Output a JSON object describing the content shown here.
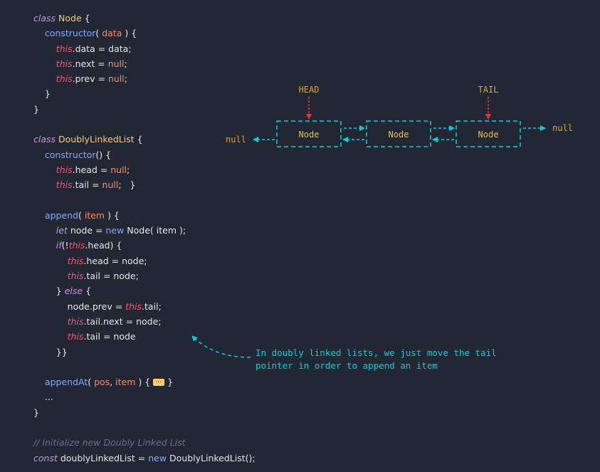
{
  "code_lines": [
    [
      {
        "t": "class",
        "c": "kw"
      },
      {
        "t": " "
      },
      {
        "t": "Node",
        "c": "cls"
      },
      {
        "t": " {"
      }
    ],
    [
      {
        "t": "    "
      },
      {
        "t": "constructor",
        "c": "fn"
      },
      {
        "t": "( "
      },
      {
        "t": "data",
        "c": "param"
      },
      {
        "t": " ) {"
      }
    ],
    [
      {
        "t": "        "
      },
      {
        "t": "this",
        "c": "this"
      },
      {
        "t": ".data = data;"
      }
    ],
    [
      {
        "t": "        "
      },
      {
        "t": "this",
        "c": "this"
      },
      {
        "t": ".next = "
      },
      {
        "t": "null",
        "c": "lit"
      },
      {
        "t": ";"
      }
    ],
    [
      {
        "t": "        "
      },
      {
        "t": "this",
        "c": "this"
      },
      {
        "t": ".prev = "
      },
      {
        "t": "null",
        "c": "lit"
      },
      {
        "t": ";"
      }
    ],
    [
      {
        "t": "    }"
      }
    ],
    [
      {
        "t": "}"
      }
    ],
    [],
    [
      {
        "t": "class",
        "c": "kw"
      },
      {
        "t": " "
      },
      {
        "t": "DoublyLinkedList",
        "c": "cls"
      },
      {
        "t": " {"
      }
    ],
    [
      {
        "t": "    "
      },
      {
        "t": "constructor",
        "c": "fn"
      },
      {
        "t": "() {"
      }
    ],
    [
      {
        "t": "        "
      },
      {
        "t": "this",
        "c": "this"
      },
      {
        "t": ".head = "
      },
      {
        "t": "null",
        "c": "lit"
      },
      {
        "t": ";"
      }
    ],
    [
      {
        "t": "        "
      },
      {
        "t": "this",
        "c": "this"
      },
      {
        "t": ".tail = "
      },
      {
        "t": "null",
        "c": "lit"
      },
      {
        "t": ";   }"
      }
    ],
    [],
    [
      {
        "t": "    "
      },
      {
        "t": "append",
        "c": "fn"
      },
      {
        "t": "( "
      },
      {
        "t": "item",
        "c": "param"
      },
      {
        "t": " ) {"
      }
    ],
    [
      {
        "t": "        "
      },
      {
        "t": "let",
        "c": "kw"
      },
      {
        "t": " node = "
      },
      {
        "t": "new",
        "c": "fn"
      },
      {
        "t": " Node( item );"
      }
    ],
    [
      {
        "t": "        "
      },
      {
        "t": "if",
        "c": "kw"
      },
      {
        "t": "(!"
      },
      {
        "t": "this",
        "c": "this"
      },
      {
        "t": ".head) {"
      }
    ],
    [
      {
        "t": "            "
      },
      {
        "t": "this",
        "c": "this"
      },
      {
        "t": ".head = node;"
      }
    ],
    [
      {
        "t": "            "
      },
      {
        "t": "this",
        "c": "this"
      },
      {
        "t": ".tail = node;"
      }
    ],
    [
      {
        "t": "        } "
      },
      {
        "t": "else",
        "c": "kw"
      },
      {
        "t": " {"
      }
    ],
    [
      {
        "t": "            node.prev = "
      },
      {
        "t": "this",
        "c": "this"
      },
      {
        "t": ".tail;"
      }
    ],
    [
      {
        "t": "            "
      },
      {
        "t": "this",
        "c": "this"
      },
      {
        "t": ".tail.next = node;"
      }
    ],
    [
      {
        "t": "            "
      },
      {
        "t": "this",
        "c": "this"
      },
      {
        "t": ".tail = node"
      }
    ],
    [
      {
        "t": "        }}"
      }
    ],
    [],
    [
      {
        "t": "    "
      },
      {
        "t": "appendAt",
        "c": "fn"
      },
      {
        "t": "( "
      },
      {
        "t": "pos",
        "c": "param"
      },
      {
        "t": ", "
      },
      {
        "t": "item",
        "c": "param"
      },
      {
        "t": " ) { "
      },
      {
        "t": "",
        "c": "fold"
      },
      {
        "t": " }"
      }
    ],
    [
      {
        "t": "    ..."
      }
    ],
    [
      {
        "t": "}"
      }
    ],
    [],
    [
      {
        "t": "// Initialize new Doubly Linked List",
        "c": "cmt"
      }
    ],
    [
      {
        "t": "const",
        "c": "kw"
      },
      {
        "t": " doublyLinkedList = "
      },
      {
        "t": "new",
        "c": "fn"
      },
      {
        "t": " DoublyLinkedList();"
      }
    ]
  ],
  "diagram": {
    "head_label": "HEAD",
    "tail_label": "TAIL",
    "nodes": [
      "Node",
      "Node",
      "Node"
    ],
    "null_left": "null",
    "null_right": "null",
    "annotation_lines": [
      "In doubly linked lists, we just move the tail",
      "pointer in order to append an item"
    ]
  },
  "colors": {
    "background": "#212733",
    "diagram_line": "#00d3d7",
    "pointer_label": "#e8a317",
    "pointer_arrow": "#e53935",
    "node_text": "#e0c44a"
  }
}
